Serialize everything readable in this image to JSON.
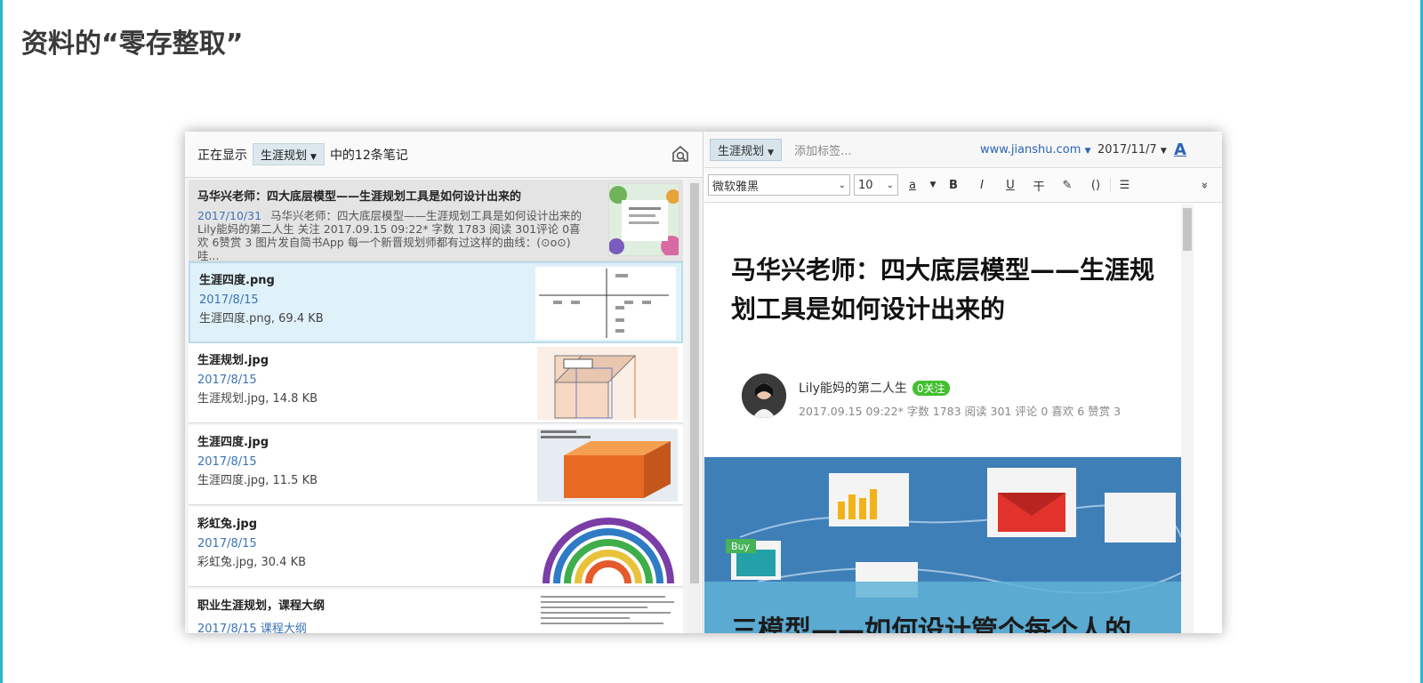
{
  "slide": {
    "title": "资料的“零存整取”"
  },
  "list_header": {
    "prefix": "正在显示",
    "notebook": "生涯规划",
    "suffix": "中的12条笔记"
  },
  "notes": [
    {
      "title": "马华兴老师：四大底层模型——生涯规划工具是如何设计出来的",
      "date": "2017/10/31",
      "snippet": "马华兴老师：四大底层模型——生涯规划工具是如何设计出来的 Lily能妈的第二人生 关注 2017.09.15 09:22* 字数 1783 阅读 301评论 0喜欢 6赞赏 3 图片发自简书App 每一个新晋规划师都有过这样的曲线：(⊙o⊙)哇..."
    },
    {
      "title": "生涯四度.png",
      "date": "2017/8/15",
      "file": "生涯四度.png, 69.4 KB"
    },
    {
      "title": "生涯规划.jpg",
      "date": "2017/8/15",
      "file": "生涯规划.jpg, 14.8 KB"
    },
    {
      "title": "生涯四度.jpg",
      "date": "2017/8/15",
      "file": "生涯四度.jpg, 11.5 KB"
    },
    {
      "title": "彩虹兔.jpg",
      "date": "2017/8/15",
      "file": "彩虹兔.jpg, 30.4 KB"
    },
    {
      "title": "职业生涯规划，课程大纲",
      "date": "2017/8/15",
      "tag": "课程大纲"
    }
  ],
  "editor": {
    "notebook_tag": "生涯规划",
    "add_tag_placeholder": "添加标签...",
    "source_url": "www.jianshu.com",
    "note_date": "2017/11/7",
    "font_name": "微软雅黑",
    "font_size": "10",
    "toolbar": {
      "color_a": "a",
      "bold": "B",
      "italic": "I",
      "underline": "U",
      "strike": "干",
      "code": "()",
      "list": "☰",
      "more": "»"
    },
    "doc_title": "马华兴老师：四大底层模型——生涯规划工具是如何设计出来的",
    "author": "Lily能妈的第二人生",
    "follow_label": "0关注",
    "meta": "2017.09.15 09:22*  字数 1783  阅读 301  评论 0  喜欢 6  赞赏 3",
    "banner_text": "三模型——如何设计管个每个人的",
    "banner_badge": "Buy"
  },
  "colors": {
    "accent": "#2bb5d0",
    "link": "#2a64b7",
    "follow_green": "#42c02e",
    "banner_blue": "#3f7fb8"
  }
}
